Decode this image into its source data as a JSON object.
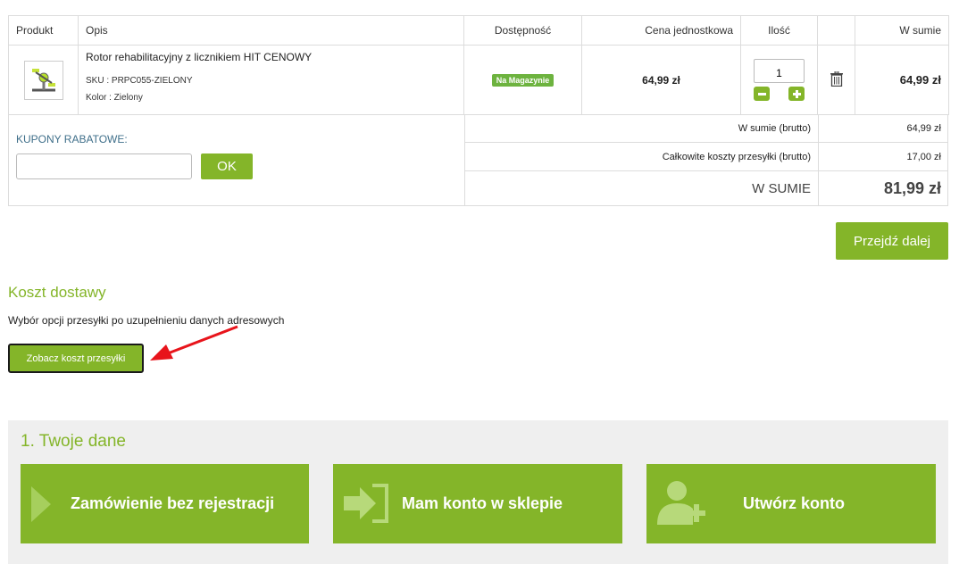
{
  "cart": {
    "headers": {
      "product": "Produkt",
      "description": "Opis",
      "availability": "Dostępność",
      "unit_price": "Cena jednostkowa",
      "quantity": "Ilość",
      "total": "W sumie"
    },
    "item": {
      "name": "Rotor rehabilitacyjny z licznikiem HIT CENOWY",
      "sku": "SKU : PRPC055-ZIELONY",
      "color": "Kolor : Zielony",
      "availability_badge": "Na Magazynie",
      "unit_price": "64,99 zł",
      "quantity": "1",
      "total": "64,99 zł"
    }
  },
  "coupon": {
    "label": "KUPONY RABATOWE:",
    "input_value": "",
    "ok_label": "OK"
  },
  "summary": {
    "brutto_label": "W sumie (brutto)",
    "brutto_value": "64,99 zł",
    "shipping_label": "Całkowite koszty przesyłki (brutto)",
    "shipping_value": "17,00 zł",
    "grand_label": "W SUMIE",
    "grand_value": "81,99 zł"
  },
  "next_button": "Przejdź dalej",
  "shipping_cost": {
    "title": "Koszt dostawy",
    "description": "Wybór opcji przesyłki po uzupełnieniu danych adresowych",
    "button": "Zobacz koszt przesyłki"
  },
  "customer": {
    "title": "1. Twoje dane",
    "options": [
      {
        "label": "Zamówienie bez rejestracji",
        "icon": "chevron-right-icon"
      },
      {
        "label": "Mam konto w sklepie",
        "icon": "sign-in-icon"
      },
      {
        "label": "Utwórz konto",
        "icon": "add-user-icon"
      }
    ]
  },
  "colors": {
    "accent_green": "#84b529",
    "badge_green": "#6db33f",
    "coupon_label_blue": "#3f6f8a",
    "annotation_red": "#e8141b"
  }
}
